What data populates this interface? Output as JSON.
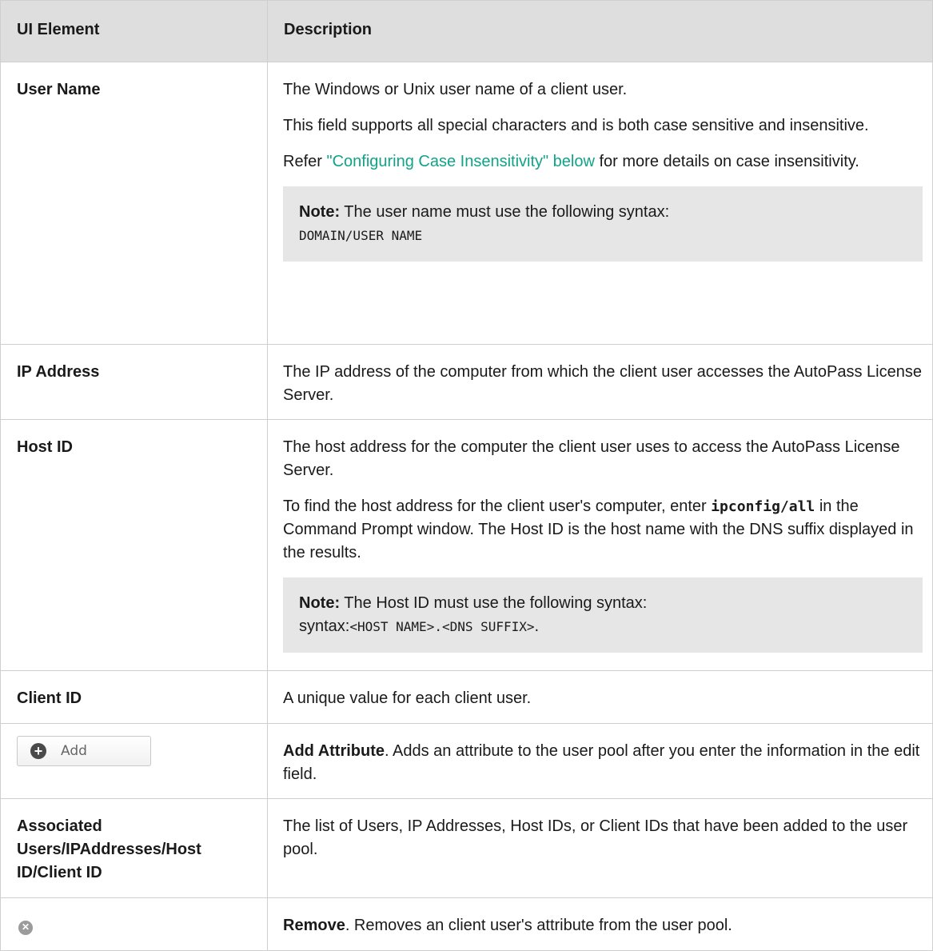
{
  "header": {
    "col1": "UI Element",
    "col2": "Description"
  },
  "rows": {
    "user_name": {
      "element": "User Name",
      "p1": "The Windows or Unix user name of a client user.",
      "p2": "This field supports all special characters and is both case sensitive and insensitive.",
      "p3_prefix": "Refer ",
      "p3_link": "\"Configuring Case Insensitivity\" below",
      "p3_suffix": " for more details on case insensitivity.",
      "note_label": "Note:",
      "note_text": " The user name must use the following syntax:",
      "note_code": "DOMAIN/USER NAME"
    },
    "ip_address": {
      "element": "IP Address",
      "p1": "The IP address of the computer from which the client user accesses the AutoPass License Server."
    },
    "host_id": {
      "element": "Host ID",
      "p1": "The host address for the computer the client user uses to access the AutoPass License Server.",
      "p2_prefix": "To find the host address for the client user's computer, enter ",
      "p2_code": "ipconfig/all",
      "p2_suffix": " in the Command Prompt window. The Host ID is the host name with the DNS suffix displayed in the results.",
      "note_label": "Note:",
      "note_text": " The Host ID must use the following syntax:",
      "note_code": "<HOST NAME>.<DNS SUFFIX>",
      "note_end": "."
    },
    "client_id": {
      "element": "Client ID",
      "p1": "A unique value for each client user."
    },
    "add": {
      "button_label": "Add",
      "icon": "plus-circle-icon",
      "bold": "Add Attribute",
      "text": ". Adds an attribute to the user pool after you enter the information in the edit field."
    },
    "associated": {
      "element": "Associated Users/IPAddresses/Host ID/Client ID",
      "p1": "The list of Users, IP Addresses, Host IDs, or Client IDs that have been added to the user pool."
    },
    "remove": {
      "icon": "remove-circle-icon",
      "bold": "Remove",
      "text": ". Removes an client user's attribute from the user pool."
    }
  }
}
